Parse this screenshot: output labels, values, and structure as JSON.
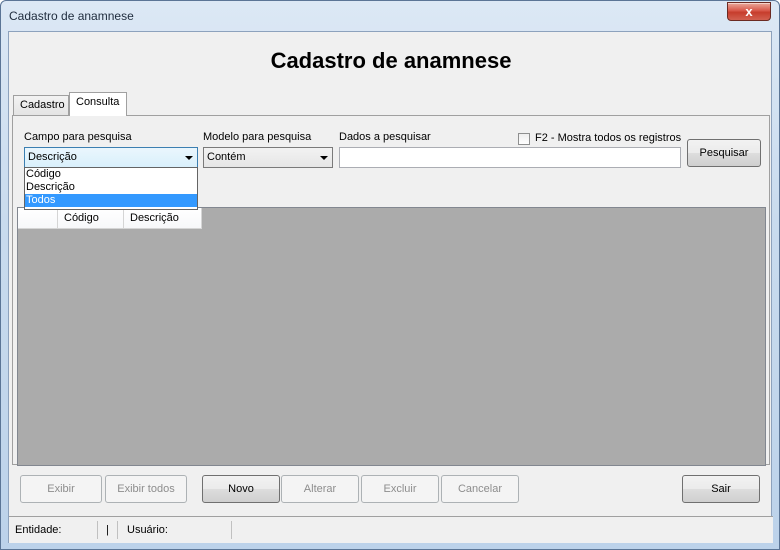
{
  "window": {
    "title": "Cadastro de anamnese",
    "close_glyph": "x"
  },
  "page": {
    "title": "Cadastro de anamnese"
  },
  "tabs": [
    {
      "label": "Cadastro",
      "active": false
    },
    {
      "label": "Consulta",
      "active": true
    }
  ],
  "search": {
    "campo_label": "Campo para pesquisa",
    "campo_value": "Descrição",
    "campo_options": [
      "Código",
      "Descrição",
      "Todos"
    ],
    "campo_highlighted": "Todos",
    "modelo_label": "Modelo para pesquisa",
    "modelo_value": "Contém",
    "dados_label": "Dados a pesquisar",
    "dados_value": "",
    "f2_label": "F2 - Mostra todos os registros",
    "f2_checked": false,
    "pesquisar_label": "Pesquisar"
  },
  "grid": {
    "columns": [
      "Código",
      "Descrição"
    ]
  },
  "buttons": {
    "exibir": "Exibir",
    "exibir_todos": "Exibir todos",
    "novo": "Novo",
    "alterar": "Alterar",
    "excluir": "Excluir",
    "cancelar": "Cancelar",
    "sair": "Sair"
  },
  "status": {
    "entidade_label": "Entidade:",
    "sep": "|",
    "usuario_label": "Usuário:"
  },
  "colors": {
    "accent_selection": "#3399ff",
    "close_button": "#c63d2c",
    "grid_background": "#ababab"
  }
}
